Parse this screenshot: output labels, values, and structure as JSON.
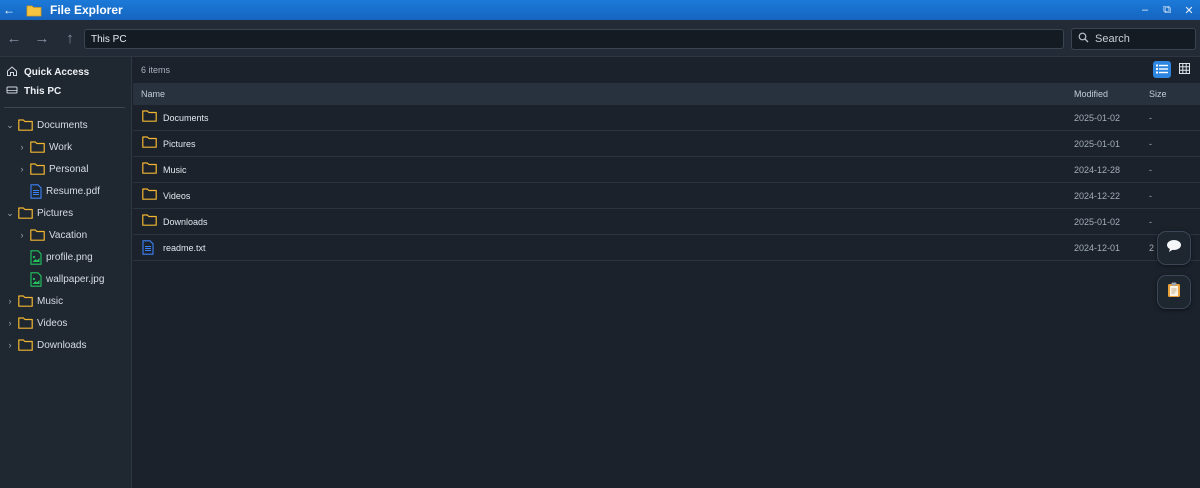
{
  "window": {
    "title": "File Explorer",
    "back_glyph": "←",
    "controls": [
      "–",
      "⧉",
      "✕"
    ]
  },
  "toolbar": {
    "back_glyph": "←",
    "forward_glyph": "→",
    "up_glyph": "↑",
    "address": "This PC",
    "search_placeholder": "Search"
  },
  "sidebar": {
    "quick_access": "Quick Access",
    "this_pc": "This PC",
    "tree": [
      {
        "label": "Documents",
        "type": "folder",
        "level": 0,
        "chevron": "⌄"
      },
      {
        "label": "Work",
        "type": "folder",
        "level": 1,
        "chevron": "›"
      },
      {
        "label": "Personal",
        "type": "folder",
        "level": 1,
        "chevron": "›"
      },
      {
        "label": "Resume.pdf",
        "type": "file-doc",
        "level": 1,
        "chevron": ""
      },
      {
        "label": "Pictures",
        "type": "folder",
        "level": 0,
        "chevron": "⌄"
      },
      {
        "label": "Vacation",
        "type": "folder",
        "level": 1,
        "chevron": "›"
      },
      {
        "label": "profile.png",
        "type": "file-image",
        "level": 1,
        "chevron": ""
      },
      {
        "label": "wallpaper.jpg",
        "type": "file-image",
        "level": 1,
        "chevron": ""
      },
      {
        "label": "Music",
        "type": "folder",
        "level": 0,
        "chevron": "›"
      },
      {
        "label": "Videos",
        "type": "folder",
        "level": 0,
        "chevron": "›"
      },
      {
        "label": "Downloads",
        "type": "folder",
        "level": 0,
        "chevron": "›"
      }
    ]
  },
  "main": {
    "item_count": "6 items",
    "columns": {
      "name": "Name",
      "modified": "Modified",
      "size": "Size"
    },
    "rows": [
      {
        "name": "Documents",
        "type": "folder",
        "modified": "2025-01-02",
        "size": "-"
      },
      {
        "name": "Pictures",
        "type": "folder",
        "modified": "2025-01-01",
        "size": "-"
      },
      {
        "name": "Music",
        "type": "folder",
        "modified": "2024-12-28",
        "size": "-"
      },
      {
        "name": "Videos",
        "type": "folder",
        "modified": "2024-12-22",
        "size": "-"
      },
      {
        "name": "Downloads",
        "type": "folder",
        "modified": "2025-01-02",
        "size": "-"
      },
      {
        "name": "readme.txt",
        "type": "file-doc",
        "modified": "2024-12-01",
        "size": "2"
      }
    ],
    "active_view": "list"
  },
  "colors": {
    "accent": "#1c7ad8",
    "folder": "#f2b630",
    "doc": "#3b82f6",
    "image": "#22c55e",
    "background": "#1b222c"
  },
  "icons": [
    "folder-icon",
    "file-doc-icon",
    "file-image-icon",
    "search-icon",
    "home-icon",
    "drive-icon",
    "list-view-icon",
    "grid-view-icon",
    "chat-icon",
    "clipboard-icon"
  ]
}
